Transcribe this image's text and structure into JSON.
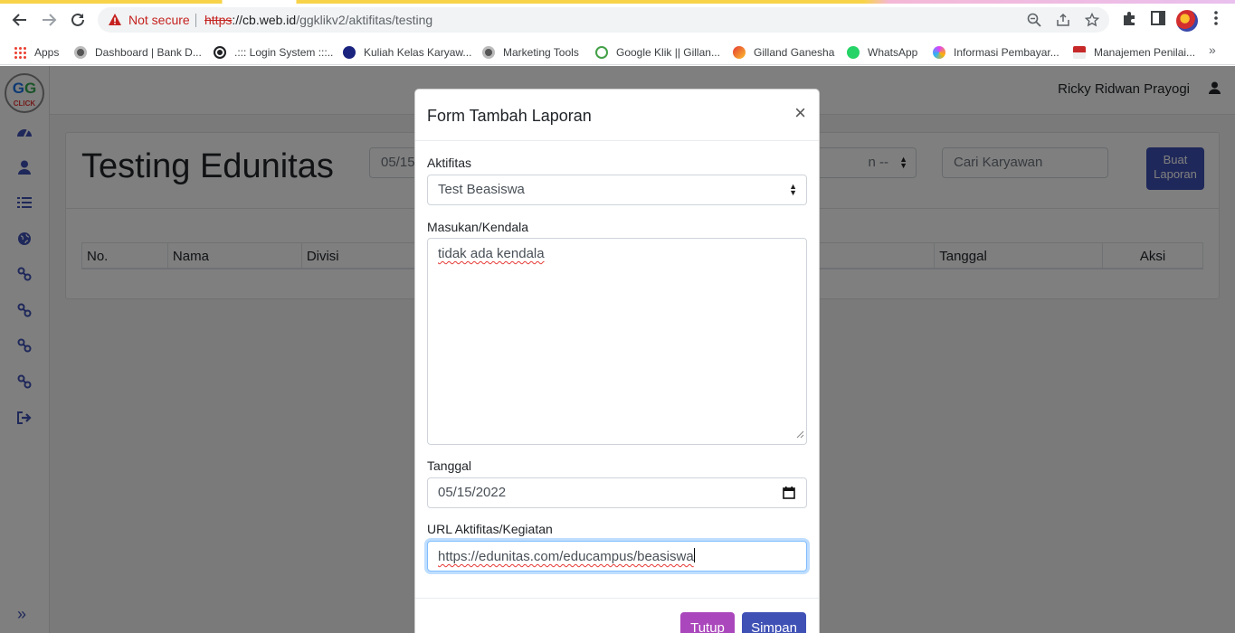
{
  "browser": {
    "not_secure": "Not secure",
    "url_scheme": "https",
    "url_host": "://cb.web.id",
    "url_path": "/ggklikv2/aktifitas/testing"
  },
  "bookmarks": [
    {
      "label": "Apps",
      "icon": "apps-grid-icon",
      "color": "#1a73e8"
    },
    {
      "label": "Dashboard | Bank D...",
      "icon": "mascot-icon",
      "color": "#555555"
    },
    {
      "label": ".::: Login System :::..",
      "icon": "globe-icon",
      "color": "#202124"
    },
    {
      "label": "Kuliah Kelas Karyaw...",
      "icon": "graduation-cap-icon",
      "color": "#1a237e"
    },
    {
      "label": "Marketing Tools",
      "icon": "mascot-icon",
      "color": "#555555"
    },
    {
      "label": "Google Klik || Gillan...",
      "icon": "ggclick-icon",
      "color": "#43a047"
    },
    {
      "label": "Gilland Ganesha",
      "icon": "gilland-icon",
      "color": "#e53935"
    },
    {
      "label": "WhatsApp",
      "icon": "whatsapp-icon",
      "color": "#25d366"
    },
    {
      "label": "Informasi Pembayar...",
      "icon": "swirl-icon",
      "color": "#e040fb"
    },
    {
      "label": "Manajemen Penilai...",
      "icon": "flag-icon",
      "color": "#c62828"
    }
  ],
  "app": {
    "logo_text": "GG",
    "logo_sub": "CLICK",
    "username": "Ricky Ridwan Prayogi",
    "page_title": "Testing Edunitas",
    "filter_date": "05/15",
    "filter_select": "n --",
    "search_placeholder": "Cari Karyawan",
    "buat_label": "Buat Laporan",
    "table_headers": [
      "No.",
      "Nama",
      "Divisi",
      "",
      "Tanggal",
      "Aksi"
    ]
  },
  "modal": {
    "title": "Form Tambah Laporan",
    "close": "×",
    "aktifitas_label": "Aktifitas",
    "aktifitas_value": "Test Beasiswa",
    "masukan_label": "Masukan/Kendala",
    "masukan_value": "tidak ada kendala",
    "tanggal_label": "Tanggal",
    "tanggal_value": "05/15/2022",
    "url_label": "URL Aktifitas/Kegiatan",
    "url_value": "https://edunitas.com/educampus/beasiswa",
    "tutup_label": "Tutup",
    "simpan_label": "Simpan"
  },
  "colors": {
    "primary": "#3f51b5",
    "tutup": "#ab47bc",
    "danger": "#c5221f"
  }
}
